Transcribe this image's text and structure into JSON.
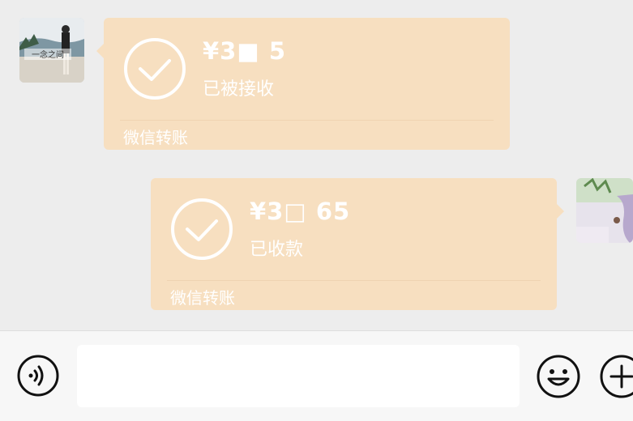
{
  "messages": [
    {
      "side": "left",
      "avatar_watermark": "一念之间",
      "amount": "¥3​■ ​5",
      "status": "已被接收",
      "footer": "微信转账",
      "icon": "check-circle-icon"
    },
    {
      "side": "right",
      "amount": "¥3​□ ​65",
      "status": "已收款",
      "footer": "微信转账",
      "icon": "check-circle-icon"
    }
  ],
  "input_bar": {
    "voice_icon": "voice-icon",
    "text_value": "",
    "emoji_icon": "emoji-icon",
    "plus_icon": "plus-icon"
  },
  "colors": {
    "background": "#ededed",
    "bubble": "#f7dfc0",
    "bubble_text": "#ffffff",
    "input_bar": "#f7f7f7"
  }
}
